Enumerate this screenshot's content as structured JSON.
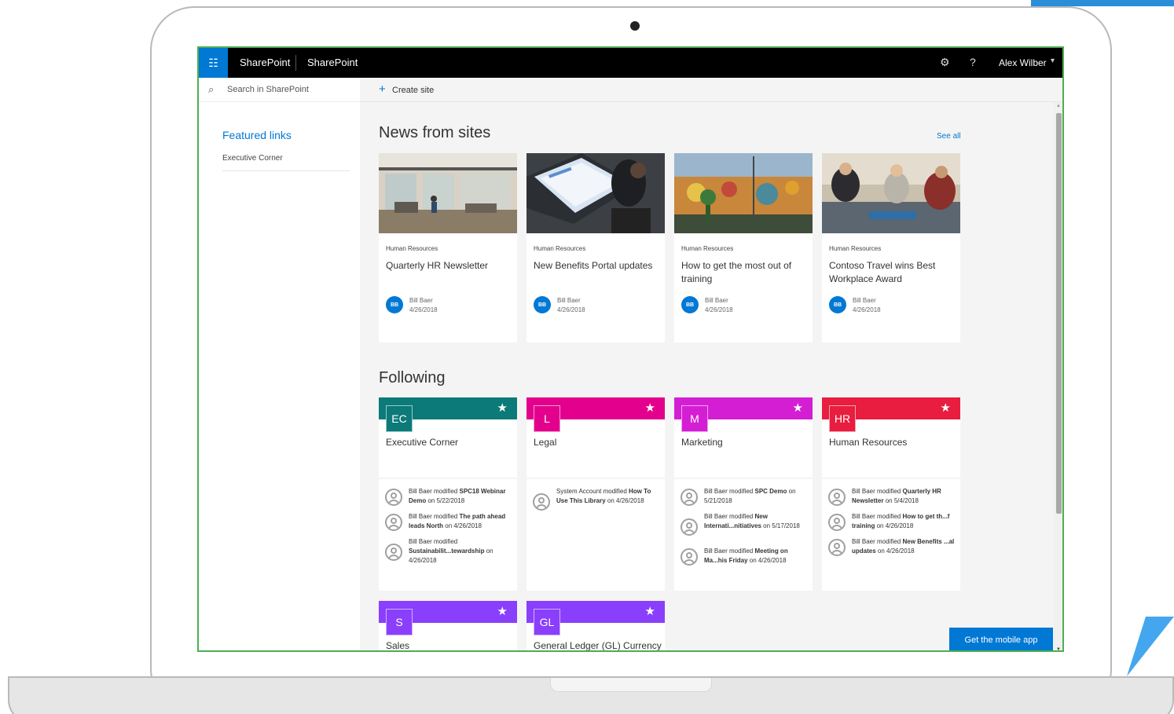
{
  "topbar": {
    "brand": "SharePoint",
    "site": "SharePoint",
    "user": "Alex Wilber"
  },
  "search": {
    "placeholder": "Search in SharePoint"
  },
  "commands": {
    "create_site": "Create site"
  },
  "featured": {
    "title": "Featured links",
    "items": [
      "Executive Corner"
    ]
  },
  "news": {
    "title": "News from sites",
    "see_all": "See all",
    "cards": [
      {
        "site": "Human Resources",
        "headline": "Quarterly HR Newsletter",
        "author_initials": "BB",
        "author": "Bill Baer",
        "date": "4/26/2018"
      },
      {
        "site": "Human Resources",
        "headline": "New Benefits Portal updates",
        "author_initials": "BB",
        "author": "Bill Baer",
        "date": "4/26/2018"
      },
      {
        "site": "Human Resources",
        "headline": "How to get the most out of training",
        "author_initials": "BB",
        "author": "Bill Baer",
        "date": "4/26/2018"
      },
      {
        "site": "Human Resources",
        "headline": "Contoso Travel wins Best Workplace Award",
        "author_initials": "BB",
        "author": "Bill Baer",
        "date": "4/26/2018"
      }
    ]
  },
  "following": {
    "title": "Following",
    "sites": [
      {
        "abbr": "EC",
        "name": "Executive Corner",
        "color": "#0b7a78",
        "activity": [
          {
            "actor": "Bill Baer modified ",
            "target": "SPC18 Webinar Demo",
            "when": " on 5/22/2018"
          },
          {
            "actor": "Bill Baer modified ",
            "target": "The path ahead leads North",
            "when": " on 4/26/2018"
          },
          {
            "actor": "Bill Baer modified ",
            "target": "Sustainabilit...tewardship",
            "when": " on 4/26/2018"
          }
        ]
      },
      {
        "abbr": "L",
        "name": "Legal",
        "color": "#e3008c",
        "activity": [
          {
            "actor": "System Account modified ",
            "target": "How To Use This Library",
            "when": " on 4/26/2018"
          }
        ]
      },
      {
        "abbr": "M",
        "name": "Marketing",
        "color": "#d41ed4",
        "activity": [
          {
            "actor": "Bill Baer modified ",
            "target": "SPC Demo",
            "when": " on 5/21/2018"
          },
          {
            "actor": "Bill Baer modified ",
            "target": "New Internati...nitiatives",
            "when": " on 5/17/2018"
          },
          {
            "actor": "Bill Baer modified ",
            "target": "Meeting on Ma...his Friday",
            "when": " on 4/26/2018"
          }
        ]
      },
      {
        "abbr": "HR",
        "name": "Human Resources",
        "color": "#e81d3f",
        "activity": [
          {
            "actor": "Bill Baer modified ",
            "target": "Quarterly HR Newsletter",
            "when": " on 5/4/2018"
          },
          {
            "actor": "Bill Baer modified ",
            "target": "How to get th...f training",
            "when": " on 4/26/2018"
          },
          {
            "actor": "Bill Baer modified ",
            "target": "New Benefits ...al updates",
            "when": " on 4/26/2018"
          }
        ]
      },
      {
        "abbr": "S",
        "name": "Sales",
        "color": "#8a3ffc",
        "activity": []
      },
      {
        "abbr": "GL",
        "name": "General Ledger (GL) Currency",
        "color": "#8a3ffc",
        "activity": []
      }
    ]
  },
  "mobile_app": "Get the mobile app",
  "icons": {
    "waffle": "app-launcher-icon",
    "gear": "gear-icon",
    "help": "help-icon",
    "search": "search-icon",
    "add": "plus-icon",
    "star": "star-icon"
  }
}
